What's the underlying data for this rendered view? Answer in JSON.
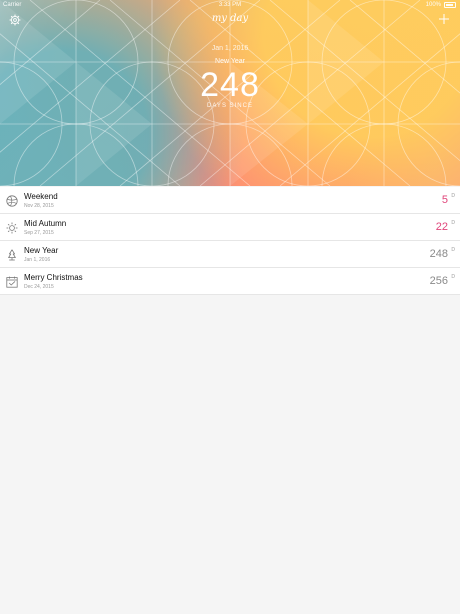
{
  "status_bar": {
    "carrier": "Carrier",
    "time": "3:33 PM",
    "battery": "100%"
  },
  "header": {
    "app_logo_text": "my day",
    "featured": {
      "date": "Jan 1, 2016",
      "title": "New Year",
      "count": "248",
      "label": "DAYS SINCE"
    }
  },
  "events": [
    {
      "name": "Weekend",
      "date": "Nov 28, 2015",
      "count": "5",
      "unit": "D",
      "icon": "basketball-icon",
      "count_color": "#e0457a"
    },
    {
      "name": "Mid Autumn",
      "date": "Sep 27, 2015",
      "count": "22",
      "unit": "D",
      "icon": "sun-icon",
      "count_color": "#e0457a"
    },
    {
      "name": "New Year",
      "date": "Jan 1, 2016",
      "count": "248",
      "unit": "D",
      "icon": "christmas-tree-icon",
      "count_color": "#8a8a8a"
    },
    {
      "name": "Merry Christmas",
      "date": "Dec 24, 2015",
      "count": "256",
      "unit": "D",
      "icon": "calendar-icon",
      "count_color": "#8a8a8a"
    }
  ]
}
